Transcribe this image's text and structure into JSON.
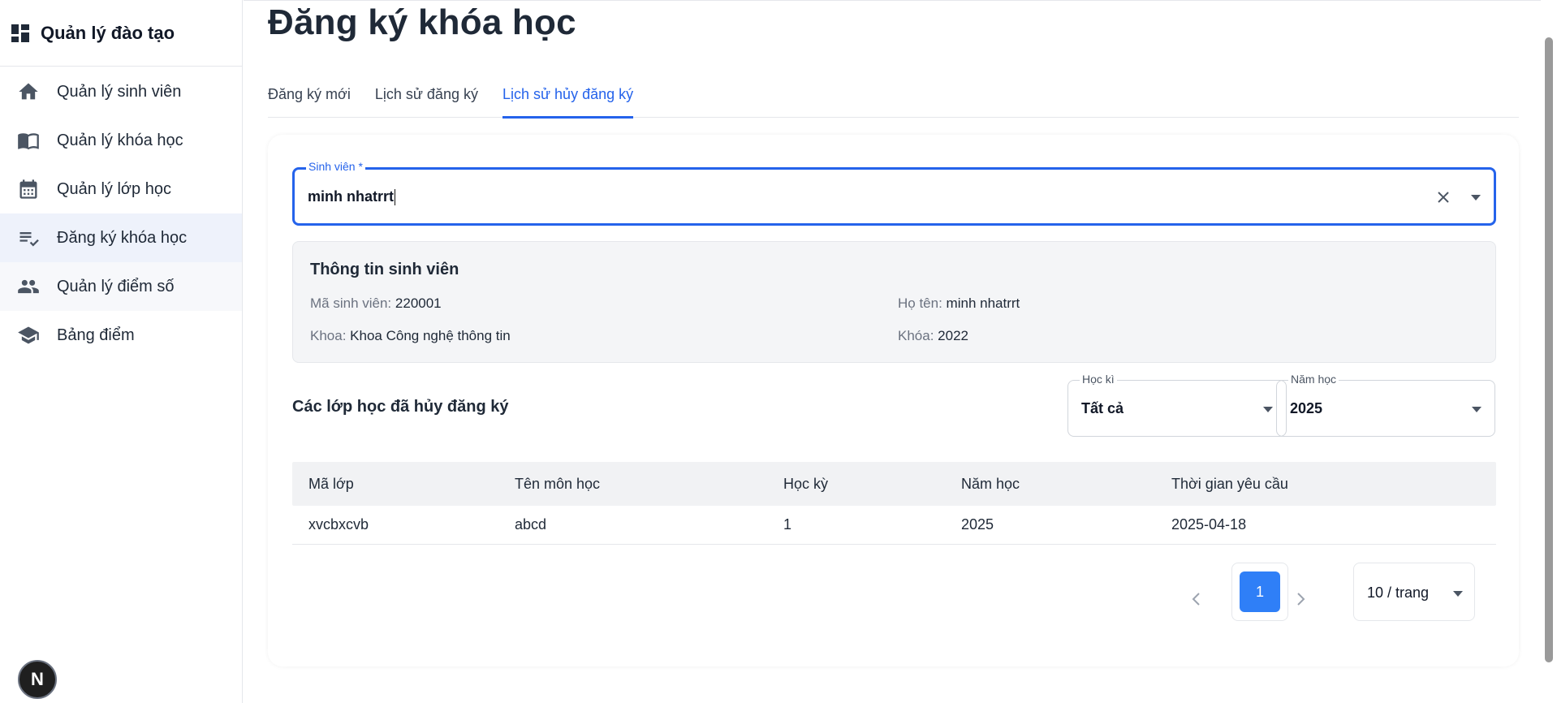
{
  "sidebar": {
    "brand": "Quản lý đào tạo",
    "items": [
      {
        "label": "Quản lý sinh viên",
        "icon": "home-icon"
      },
      {
        "label": "Quản lý khóa học",
        "icon": "book-icon"
      },
      {
        "label": "Quản lý lớp học",
        "icon": "calendar-icon"
      },
      {
        "label": "Đăng ký khóa học",
        "icon": "checklist-icon"
      },
      {
        "label": "Quản lý điểm số",
        "icon": "people-icon"
      },
      {
        "label": "Bảng điểm",
        "icon": "school-icon"
      }
    ],
    "badge": "N"
  },
  "page": {
    "title": "Đăng ký khóa học",
    "tabs": [
      "Đăng ký mới",
      "Lịch sử đăng ký",
      "Lịch sử hủy đăng ký"
    ],
    "active_tab": "Lịch sử hủy đăng ký"
  },
  "student_field": {
    "label": "Sinh viên *",
    "value": "minh nhatrrt"
  },
  "student_info": {
    "title": "Thông tin sinh viên",
    "id_key": "Mã sinh viên:",
    "id_val": "220001",
    "name_key": "Họ tên:",
    "name_val": "minh nhatrrt",
    "faculty_key": "Khoa:",
    "faculty_val": "Khoa Công nghệ thông tin",
    "cohort_key": "Khóa:",
    "cohort_val": "2022"
  },
  "section": {
    "title": "Các lớp học đã hủy đăng ký",
    "semester_label": "Học kì",
    "semester_value": "Tất cả",
    "year_label": "Năm học",
    "year_value": "2025"
  },
  "table": {
    "headers": [
      "Mã lớp",
      "Tên môn học",
      "Học kỳ",
      "Năm học",
      "Thời gian yêu cầu"
    ],
    "rows": [
      [
        "xvcbxcvb",
        "abcd",
        "1",
        "2025",
        "2025-04-18"
      ]
    ]
  },
  "pagination": {
    "current": "1",
    "page_size": "10 / trang"
  },
  "colors": {
    "accent": "#2563eb",
    "active_nav_bg": "#eef2fb",
    "info_bg": "#f4f5f7"
  }
}
